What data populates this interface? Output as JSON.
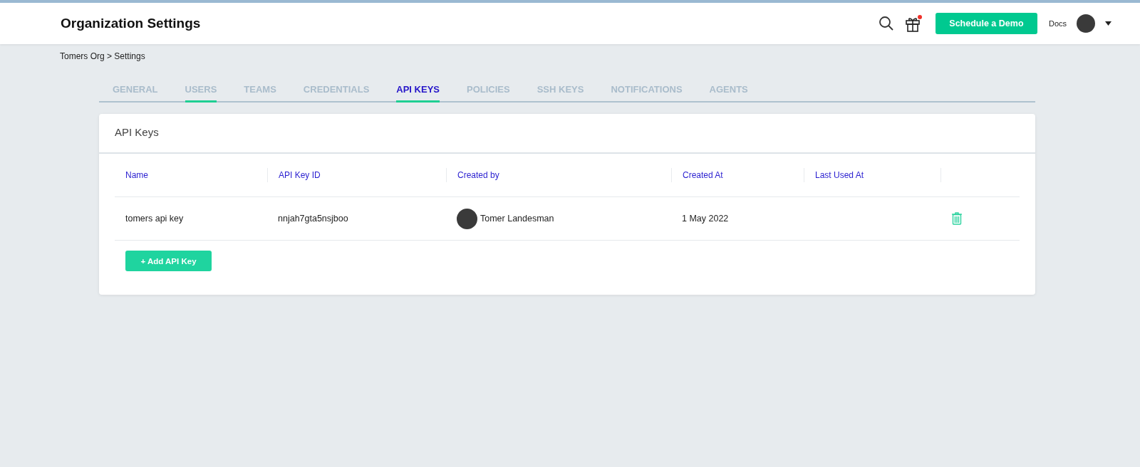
{
  "header": {
    "title": "Organization Settings",
    "gift_notification": true,
    "demo_button": "Schedule a Demo",
    "docs_link": "Docs"
  },
  "breadcrumb": "Tomers Org > Settings",
  "tabs": [
    {
      "label": "GENERAL",
      "selected": false,
      "underlined": false
    },
    {
      "label": "USERS",
      "selected": false,
      "underlined": true
    },
    {
      "label": "TEAMS",
      "selected": false,
      "underlined": false
    },
    {
      "label": "CREDENTIALS",
      "selected": false,
      "underlined": false
    },
    {
      "label": "API KEYS",
      "selected": true,
      "underlined": true
    },
    {
      "label": "POLICIES",
      "selected": false,
      "underlined": false
    },
    {
      "label": "SSH KEYS",
      "selected": false,
      "underlined": false
    },
    {
      "label": "NOTIFICATIONS",
      "selected": false,
      "underlined": false
    },
    {
      "label": "AGENTS",
      "selected": false,
      "underlined": false
    }
  ],
  "card": {
    "title": "API Keys",
    "table": {
      "columns": [
        "Name",
        "API Key ID",
        "Created by",
        "Created At",
        "Last Used At"
      ],
      "rows": [
        {
          "name": "tomers api key",
          "key_id": "nnjah7gta5nsjboo",
          "created_by": "Tomer Landesman",
          "created_at": "1 May 2022"
        }
      ]
    },
    "add_button": "+ Add API Key"
  }
}
